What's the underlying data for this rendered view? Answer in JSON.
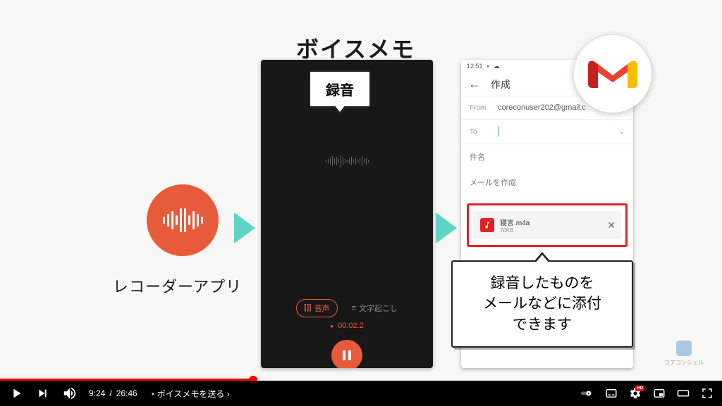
{
  "heading": "ボイスメモ",
  "recorder_label": "レコーダーアプリ",
  "callout_rec": "録音",
  "callout_attach": "録音したものを\nメールなどに添付\nできます",
  "dark": {
    "tab_audio": "音声",
    "tab_transcribe": "文字起こし",
    "timer": "00:02.2"
  },
  "gmail": {
    "status_time": "12:51",
    "title": "作成",
    "from_label": "From",
    "from_value": "coreconuser202@gmail.c",
    "to_label": "To",
    "subject_ph": "件名",
    "body_ph": "メールを作成",
    "attach_name": "寝言.m4a",
    "attach_size": "70KB"
  },
  "watermark": "コアコンシェル",
  "yt": {
    "current": "9:24",
    "total": "26:46",
    "chapter": "・ボイスメモを送る",
    "hd": "HD"
  }
}
